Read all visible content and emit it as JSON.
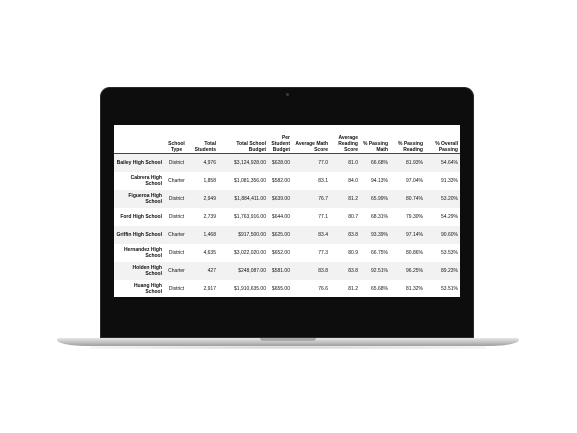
{
  "table": {
    "columns": [
      "School Type",
      "Total Students",
      "Total School Budget",
      "Per Student Budget",
      "Average Math Score",
      "Average Reading Score",
      "% Passing Math",
      "% Passing Reading",
      "% Overall Passing"
    ],
    "rows": [
      {
        "name": "Bailey High School",
        "cells": [
          "District",
          "4,976",
          "$3,124,928.00",
          "$628.00",
          "77.0",
          "81.0",
          "66.68%",
          "81.93%",
          "54.64%"
        ]
      },
      {
        "name": "Cabrera High School",
        "cells": [
          "Charter",
          "1,858",
          "$1,081,356.00",
          "$582.00",
          "83.1",
          "84.0",
          "94.13%",
          "97.04%",
          "91.33%"
        ]
      },
      {
        "name": "Figueroa High School",
        "cells": [
          "District",
          "2,949",
          "$1,884,411.00",
          "$639.00",
          "76.7",
          "81.2",
          "65.99%",
          "80.74%",
          "53.20%"
        ]
      },
      {
        "name": "Ford High School",
        "cells": [
          "District",
          "2,739",
          "$1,763,916.00",
          "$644.00",
          "77.1",
          "80.7",
          "68.31%",
          "79.30%",
          "54.29%"
        ]
      },
      {
        "name": "Griffin High School",
        "cells": [
          "Charter",
          "1,468",
          "$917,500.00",
          "$625.00",
          "83.4",
          "83.8",
          "93.39%",
          "97.14%",
          "90.60%"
        ]
      },
      {
        "name": "Hernandez High School",
        "cells": [
          "District",
          "4,635",
          "$3,022,020.00",
          "$652.00",
          "77.3",
          "80.9",
          "66.75%",
          "80.86%",
          "53.53%"
        ]
      },
      {
        "name": "Holden High School",
        "cells": [
          "Charter",
          "427",
          "$248,087.00",
          "$581.00",
          "83.8",
          "83.8",
          "92.51%",
          "96.25%",
          "89.23%"
        ]
      },
      {
        "name": "Huang High School",
        "cells": [
          "District",
          "2,917",
          "$1,910,635.00",
          "$655.00",
          "76.6",
          "81.2",
          "65.68%",
          "81.32%",
          "53.51%"
        ]
      }
    ]
  }
}
